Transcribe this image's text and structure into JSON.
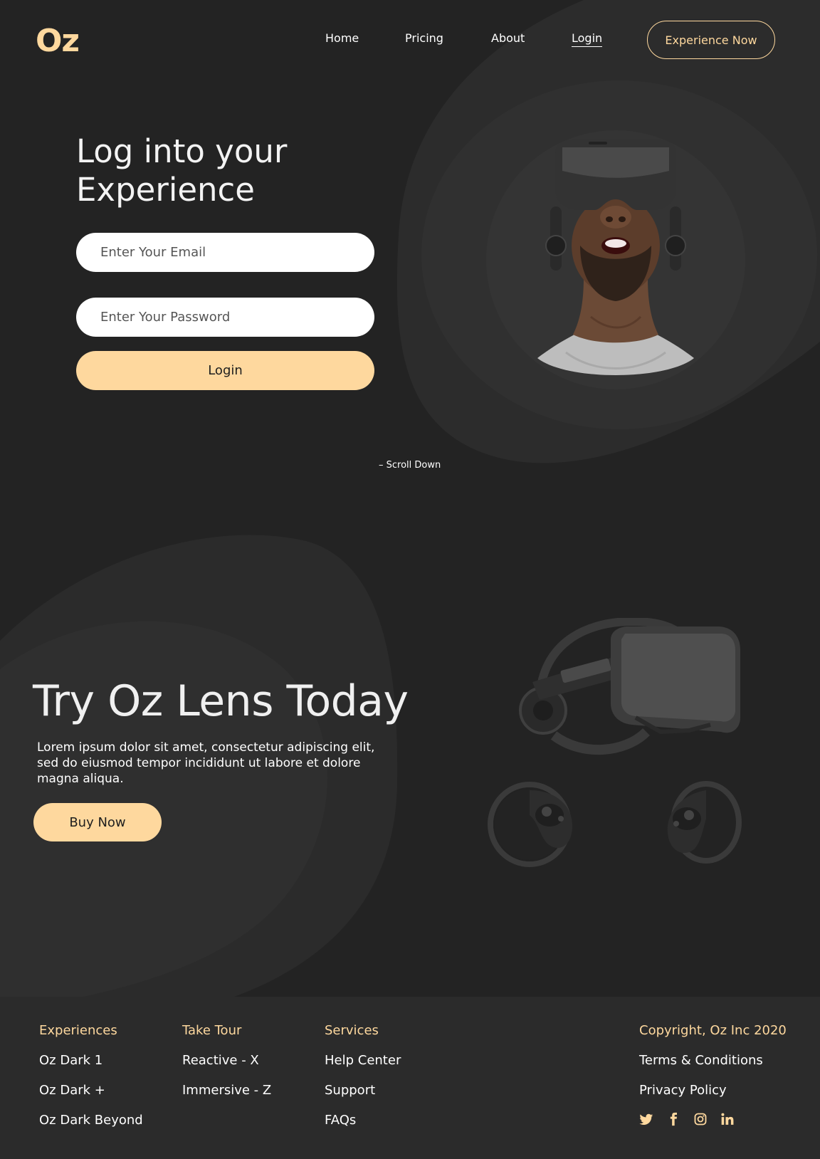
{
  "brand": {
    "logo": "Oz",
    "accent_color": "#fed89e",
    "background_color": "#232323"
  },
  "nav": {
    "items": [
      {
        "label": "Home"
      },
      {
        "label": "Pricing"
      },
      {
        "label": "About"
      },
      {
        "label": "Login",
        "active": true
      }
    ],
    "cta_label": "Experience Now"
  },
  "login": {
    "title_line1": "Log into your",
    "title_line2": "Experience",
    "email_placeholder": "Enter Your Email",
    "password_placeholder": "Enter Your Password",
    "submit_label": "Login",
    "scroll_hint": "– Scroll Down"
  },
  "product": {
    "title": "Try Oz Lens Today",
    "description": "Lorem ipsum dolor sit amet, consectetur adipiscing elit, sed do eiusmod tempor incididunt ut labore et dolore magna aliqua.",
    "buy_label": "Buy Now"
  },
  "footer": {
    "columns": [
      {
        "heading": "Experiences",
        "links": [
          "Oz Dark 1",
          "Oz Dark +",
          "Oz Dark Beyond"
        ]
      },
      {
        "heading": "Take Tour",
        "links": [
          "Reactive - X",
          "Immersive - Z"
        ]
      },
      {
        "heading": "Services",
        "links": [
          "Help Center",
          "Support",
          "FAQs"
        ]
      }
    ],
    "legal": {
      "copyright": "Copyright, Oz Inc 2020",
      "links": [
        "Terms & Conditions",
        "Privacy Policy"
      ]
    },
    "socials": [
      "twitter-icon",
      "facebook-icon",
      "instagram-icon",
      "linkedin-icon"
    ]
  }
}
